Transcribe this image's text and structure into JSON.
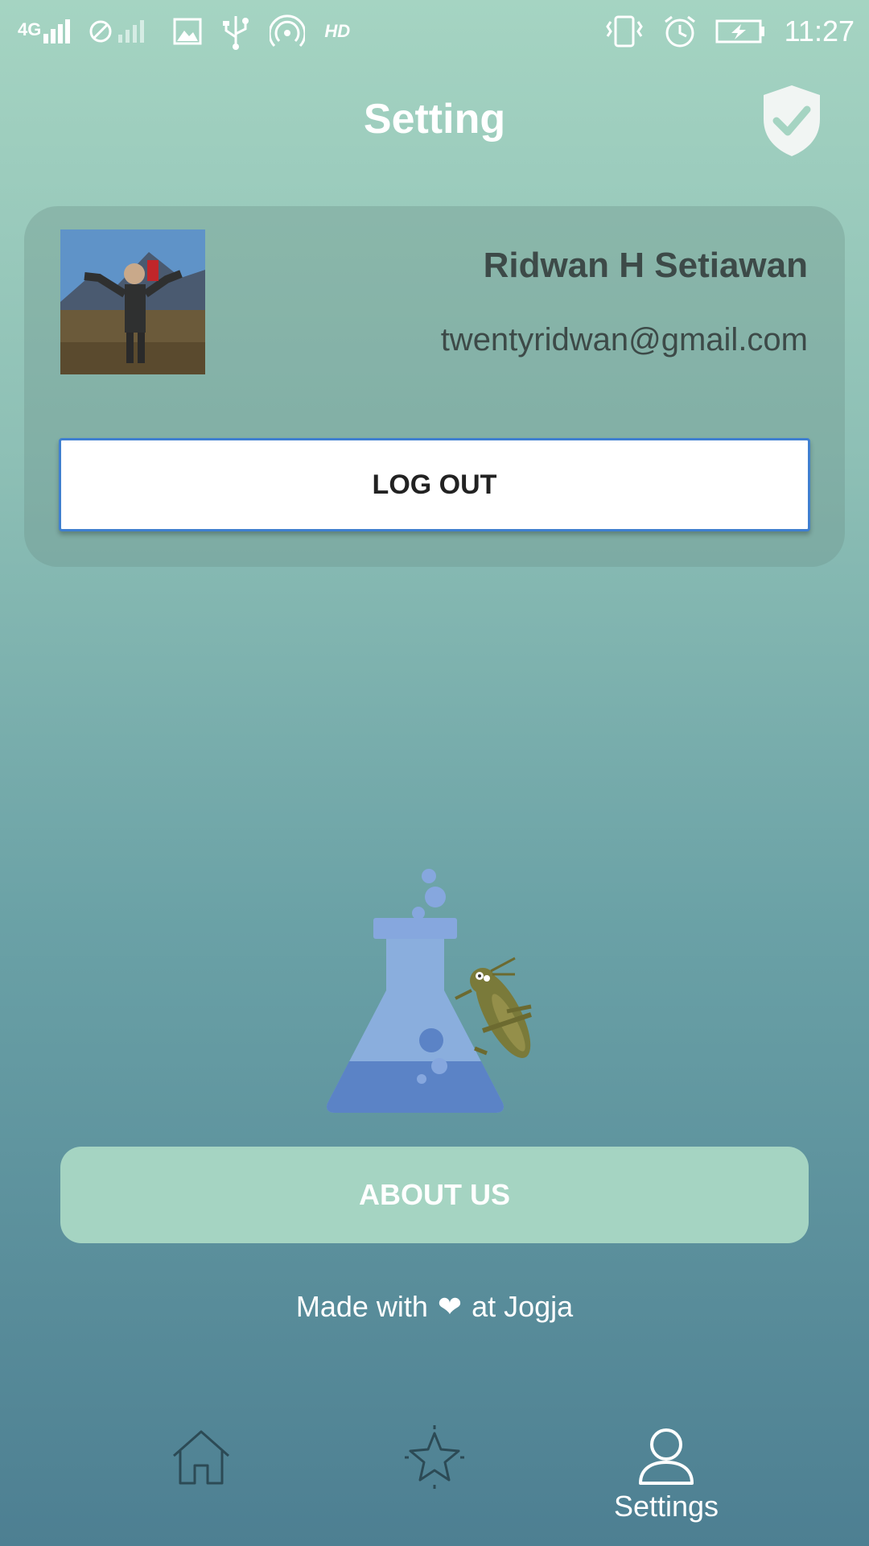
{
  "status_bar": {
    "network": "4G",
    "hd": "HD",
    "time": "11:27"
  },
  "header": {
    "title": "Setting"
  },
  "profile": {
    "name": "Ridwan H Setiawan",
    "email": "twentyridwan@gmail.com",
    "logout_label": "LOG OUT"
  },
  "about_label": "ABOUT US",
  "footer": {
    "made_prefix": "Made with",
    "heart": "❤",
    "made_suffix": "at Jogja"
  },
  "bottom_nav": {
    "settings_label": "Settings"
  },
  "colors": {
    "accent": "#a5d4c2",
    "dark_text": "#3d4a48",
    "logout_border": "#3f7fd0"
  }
}
